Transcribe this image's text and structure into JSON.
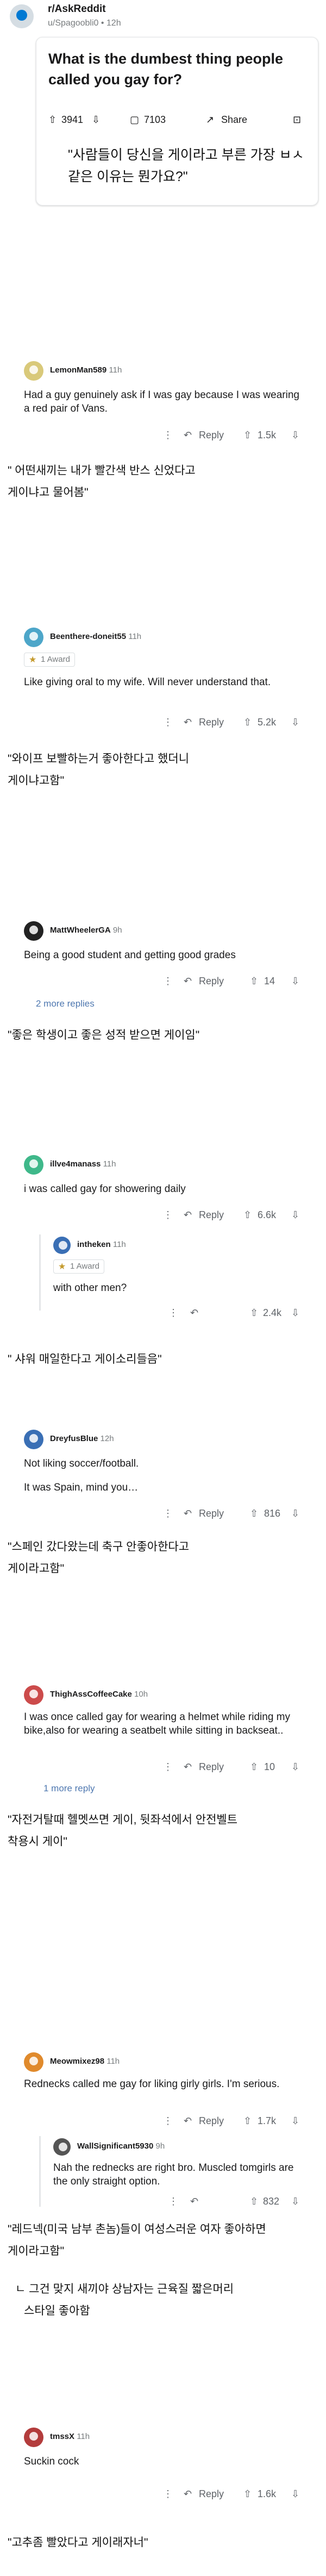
{
  "post": {
    "subreddit": "r/AskReddit",
    "meta": "u/Spagoobli0 • 12h",
    "title": "What is the dumbest thing people called you gay for?",
    "upvotes": "3941",
    "comments": "7103",
    "share_label": "Share",
    "translation": "\"사람들이 당신을 게이라고 부른 가장 ㅂㅅ같은 이유는 뭔가요?\""
  },
  "actions": {
    "reply_label": "Reply"
  },
  "comments": [
    {
      "username": "LemonMan589",
      "time": "11h",
      "text": "Had a guy genuinely ask if I was gay because I was wearing a red pair of Vans.",
      "score": "1.5k",
      "translation_lines": [
        "\" 어떤새끼는 내가 빨간색 반스 신었다고",
        "게이냐고 물어봄\""
      ]
    },
    {
      "username": "Beenthere-doneit55",
      "time": "11h",
      "award": "1 Award",
      "text": "Like giving oral to my wife.  Will never understand that.",
      "score": "5.2k",
      "translation_lines": [
        "\"와이프 보빨하는거 좋아한다고 했더니",
        "게이냐고함\""
      ]
    },
    {
      "username": "MattWheelerGA",
      "time": "9h",
      "text": "Being a good student and getting good grades",
      "score": "14",
      "more": "2 more replies",
      "translation_lines": [
        "\"좋은 학생이고 좋은 성적 받으면 게이임\""
      ]
    },
    {
      "username": "illve4manass",
      "time": "11h",
      "text": "i was called gay for showering daily",
      "score": "6.6k",
      "reply": {
        "username": "intheken",
        "time": "11h",
        "award": "1 Award",
        "text": "with other men?",
        "score": "2.4k"
      },
      "translation_lines": [
        "\" 샤워 매일한다고 게이소리들음\""
      ]
    },
    {
      "username": "DreyfusBlue",
      "time": "12h",
      "text": "Not liking soccer/football.",
      "text2": "It was Spain, mind you…",
      "score": "816",
      "translation_lines": [
        "\"스페인 갔다왔는데 축구 안좋아한다고",
        "게이라고함\""
      ]
    },
    {
      "username": "ThighAssCoffeeCake",
      "time": "10h",
      "text": "I was once called gay for wearing a helmet while riding my bike,also for wearing a seatbelt while sitting in backseat..",
      "score": "10",
      "more": "1 more reply",
      "translation_lines": [
        "\"자전거탈때 헬멧쓰면 게이, 뒷좌석에서 안전벨트",
        "착용시 게이\""
      ]
    },
    {
      "username": "Meowmixez98",
      "time": "11h",
      "text": "Rednecks called me gay for liking girly girls. I'm serious.",
      "score": "1.7k",
      "reply": {
        "username": "WallSignificant5930",
        "time": "9h",
        "text": "Nah the rednecks are right bro. Muscled tomgirls are the only straight option.",
        "score": "832"
      },
      "translation_lines": [
        "\"레드넥(미국 남부 촌놈)들이 여성스러운 여자 좋아하면",
        "게이라고함\""
      ],
      "translation2_lines": [
        "ㄴ 그건 맞지 새끼야 상남자는 근육질 짧은머리",
        "스타일 좋아함"
      ]
    },
    {
      "username": "tmssX",
      "time": "11h",
      "text": "Suckin cock",
      "score": "1.6k",
      "translation_lines": [
        "\"고추좀 빨았다고 게이래자너\""
      ]
    }
  ],
  "colors": {
    "avatar1": "#d9c97a",
    "avatar2": "#4da6c9",
    "avatar3": "#222222",
    "avatar4": "#3fb88a",
    "avatar5": "#3a6fb5",
    "avatar6": "#cc4b4b",
    "avatar7": "#e08a2c",
    "avatar8": "#b33c3c",
    "link": "#4f78b0"
  }
}
